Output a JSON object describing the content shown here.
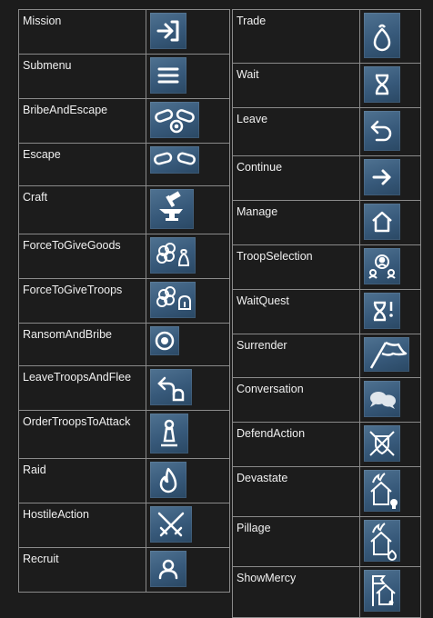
{
  "left_rows": [
    {
      "label": "Mission",
      "icon": "mission-arrow-icon"
    },
    {
      "label": "Submenu",
      "icon": "submenu-lines-icon"
    },
    {
      "label": "BribeAndEscape",
      "icon": "chain-coin-icon"
    },
    {
      "label": "Escape",
      "icon": "broken-chain-icon"
    },
    {
      "label": "Craft",
      "icon": "anvil-hammer-icon"
    },
    {
      "label": "ForceToGiveGoods",
      "icon": "fist-bag-icon"
    },
    {
      "label": "ForceToGiveTroops",
      "icon": "fist-helmet-icon"
    },
    {
      "label": "RansomAndBribe",
      "icon": "coin-icon"
    },
    {
      "label": "LeaveTroopsAndFlee",
      "icon": "return-helmet-icon"
    },
    {
      "label": "OrderTroopsToAttack",
      "icon": "chess-pawn-icon"
    },
    {
      "label": "Raid",
      "icon": "flame-icon"
    },
    {
      "label": "HostileAction",
      "icon": "crossed-swords-icon"
    },
    {
      "label": "Recruit",
      "icon": "recruit-person-icon"
    }
  ],
  "right_rows": [
    {
      "label": "Trade",
      "icon": "money-bag-icon"
    },
    {
      "label": "Wait",
      "icon": "hourglass-icon"
    },
    {
      "label": "Leave",
      "icon": "return-arrow-icon"
    },
    {
      "label": "Continue",
      "icon": "right-arrow-icon"
    },
    {
      "label": "Manage",
      "icon": "house-icon"
    },
    {
      "label": "TroopSelection",
      "icon": "troops-group-icon"
    },
    {
      "label": "WaitQuest",
      "icon": "hourglass-exclamation-icon"
    },
    {
      "label": "Surrender",
      "icon": "white-flag-icon"
    },
    {
      "label": "Conversation",
      "icon": "speech-bubbles-icon"
    },
    {
      "label": "DefendAction",
      "icon": "shield-swords-icon"
    },
    {
      "label": "Devastate",
      "icon": "burning-house-skull-icon"
    },
    {
      "label": "Pillage",
      "icon": "burning-house-bag-icon"
    },
    {
      "label": "ShowMercy",
      "icon": "flag-house-icon"
    }
  ]
}
